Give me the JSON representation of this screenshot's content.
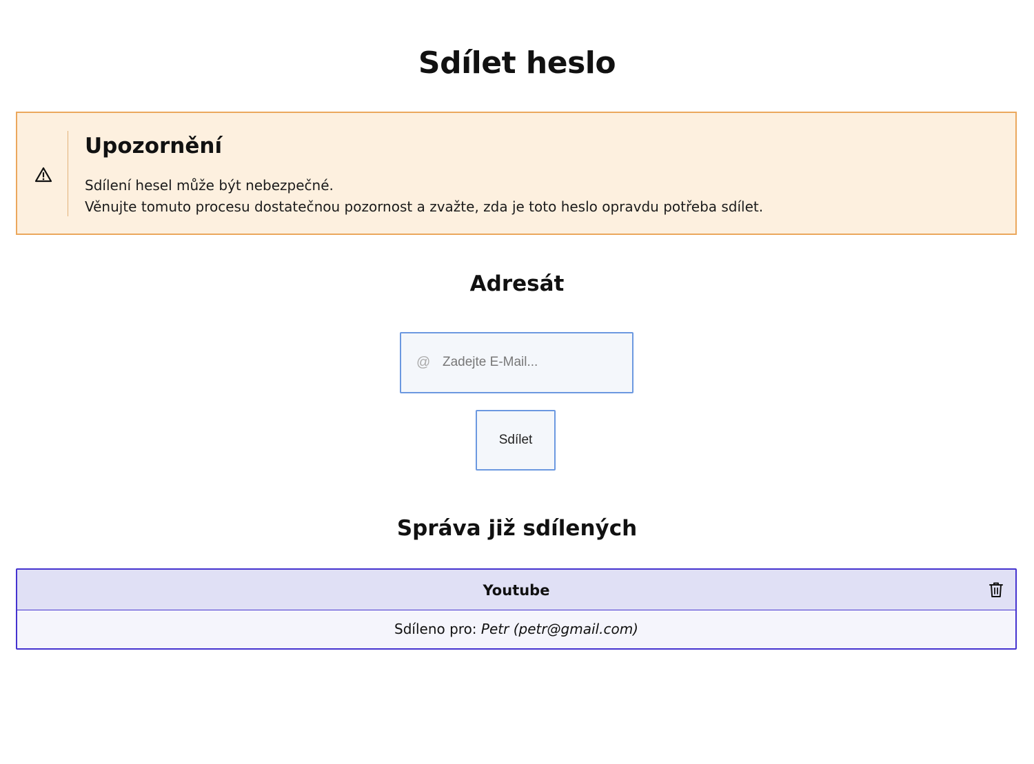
{
  "page": {
    "title": "Sdílet heslo"
  },
  "warning": {
    "icon": "warning-triangle-icon",
    "title": "Upozornění",
    "line1": "Sdílení hesel může být nebezpečné.",
    "line2": "Věnujte tomuto procesu dostatečnou pozornost a zvažte, zda je toto heslo opravdu potřeba sdílet.",
    "background_color": "#fdf0df",
    "border_color": "#eba75c"
  },
  "recipient": {
    "heading": "Adresát",
    "email_icon": "@",
    "email_placeholder": "Zadejte E-Mail...",
    "email_value": "",
    "share_button_label": "Sdílet",
    "accent_color": "#6b98e0"
  },
  "manage": {
    "heading": "Správa již sdílených",
    "accent_color": "#4432cf",
    "items": [
      {
        "name": "Youtube",
        "shared_label": "Sdíleno pro:",
        "shared_with": "Petr (petr@gmail.com)",
        "delete_icon": "trash-icon"
      }
    ]
  }
}
